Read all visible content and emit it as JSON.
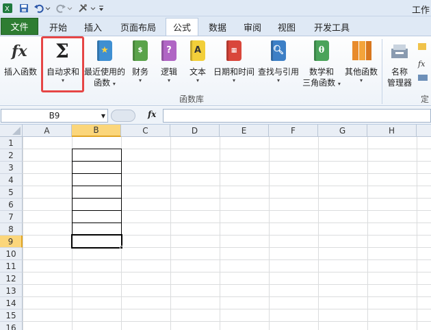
{
  "titlebar": {
    "title": "工作",
    "icons": [
      "excel-logo-icon",
      "save-icon",
      "undo-icon",
      "redo-icon",
      "tools-icon"
    ]
  },
  "tabs": {
    "file": "文件",
    "items": [
      "开始",
      "插入",
      "页面布局",
      "公式",
      "数据",
      "审阅",
      "视图",
      "开发工具"
    ],
    "active": "公式"
  },
  "ribbon": {
    "insert_function": "插入函数",
    "autosum": "自动求和",
    "recent": [
      "最近使用的",
      "函数"
    ],
    "finance": "财务",
    "logic": "逻辑",
    "text": "文本",
    "datetime": "日期和时间",
    "lookup": "查找与引用",
    "math": [
      "数学和",
      "三角函数"
    ],
    "other": "其他函数",
    "name_manager": [
      "名称",
      "管理器"
    ],
    "group_label": "函数库",
    "group_label_right": "定"
  },
  "formula_bar": {
    "name_box": "B9",
    "fx": "fx",
    "content": ""
  },
  "grid": {
    "columns": [
      "A",
      "B",
      "C",
      "D",
      "E",
      "F",
      "G",
      "H"
    ],
    "rows": [
      "1",
      "2",
      "3",
      "4",
      "5",
      "6",
      "7",
      "8",
      "9",
      "10",
      "11",
      "12",
      "13",
      "14",
      "15",
      "16"
    ],
    "selected_column": "B",
    "selected_row": "9"
  },
  "colors": {
    "file_tab": "#2e7d32",
    "highlight": "#e64545",
    "selected_header": "#fbd67b"
  }
}
